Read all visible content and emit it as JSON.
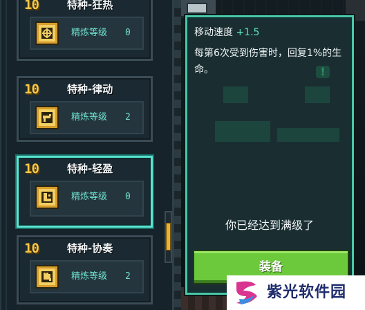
{
  "talents": [
    {
      "level": "10",
      "name": "特种-狂热",
      "refine_label": "精炼等级",
      "refine_level": "0",
      "icon": "crosshair-chip-icon",
      "selected": false
    },
    {
      "level": "10",
      "name": "特种-律动",
      "refine_label": "精炼等级",
      "refine_level": "2",
      "icon": "gun-chip-icon",
      "selected": false
    },
    {
      "level": "10",
      "name": "特种-轻盈",
      "refine_label": "精炼等级",
      "refine_level": "0",
      "icon": "boot-chip-icon",
      "selected": true
    },
    {
      "level": "10",
      "name": "特种-协奏",
      "refine_label": "精炼等级",
      "refine_level": "2",
      "icon": "fist-chip-icon",
      "selected": false
    }
  ],
  "detail": {
    "stat_label": "移动速度",
    "stat_value": "+1.5",
    "description": "每第6次受到伤害时，回复1%的生命。",
    "info_icon": "exclamation-icon",
    "max_level_text": "你已经达到满级了",
    "equip_label": "装备"
  },
  "colors": {
    "accent_teal": "#5ae6d2",
    "level_gold": "#f6c944",
    "equip_green": "#6cc93c"
  },
  "watermark": {
    "text": "紫光软件园"
  }
}
